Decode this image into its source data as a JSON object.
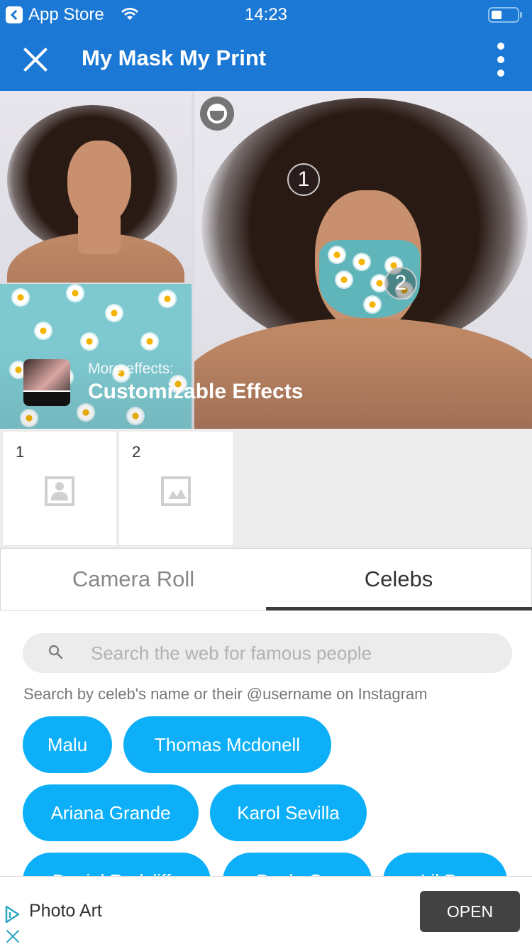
{
  "status_bar": {
    "back_app": "App Store",
    "time": "14:23"
  },
  "nav": {
    "title": "My Mask My Print"
  },
  "preview": {
    "markers": [
      "1",
      "2"
    ],
    "effects_subtitle": "More effects:",
    "effects_title": "Customizable Effects"
  },
  "slots": [
    {
      "number": "1",
      "placeholder_icon": "person-placeholder-icon"
    },
    {
      "number": "2",
      "placeholder_icon": "image-placeholder-icon"
    }
  ],
  "tabs": [
    {
      "label": "Camera Roll",
      "active": false
    },
    {
      "label": "Celebs",
      "active": true
    }
  ],
  "search": {
    "placeholder": "Search the web for famous people",
    "value": "",
    "hint": "Search by celeb's name or their @username on Instagram"
  },
  "celebs": [
    "Malu",
    "Thomas Mcdonell",
    "Ariana Grande",
    "Karol Sevilla",
    "Daniel Radcliffe",
    "Paulo G...",
    "Lil P..."
  ],
  "ad": {
    "name": "Photo Art",
    "cta": "OPEN"
  },
  "colors": {
    "header": "#1b78d4",
    "chip": "#0db0f8",
    "tab_indicator": "#3d3d3d",
    "ad_button": "#424242"
  }
}
